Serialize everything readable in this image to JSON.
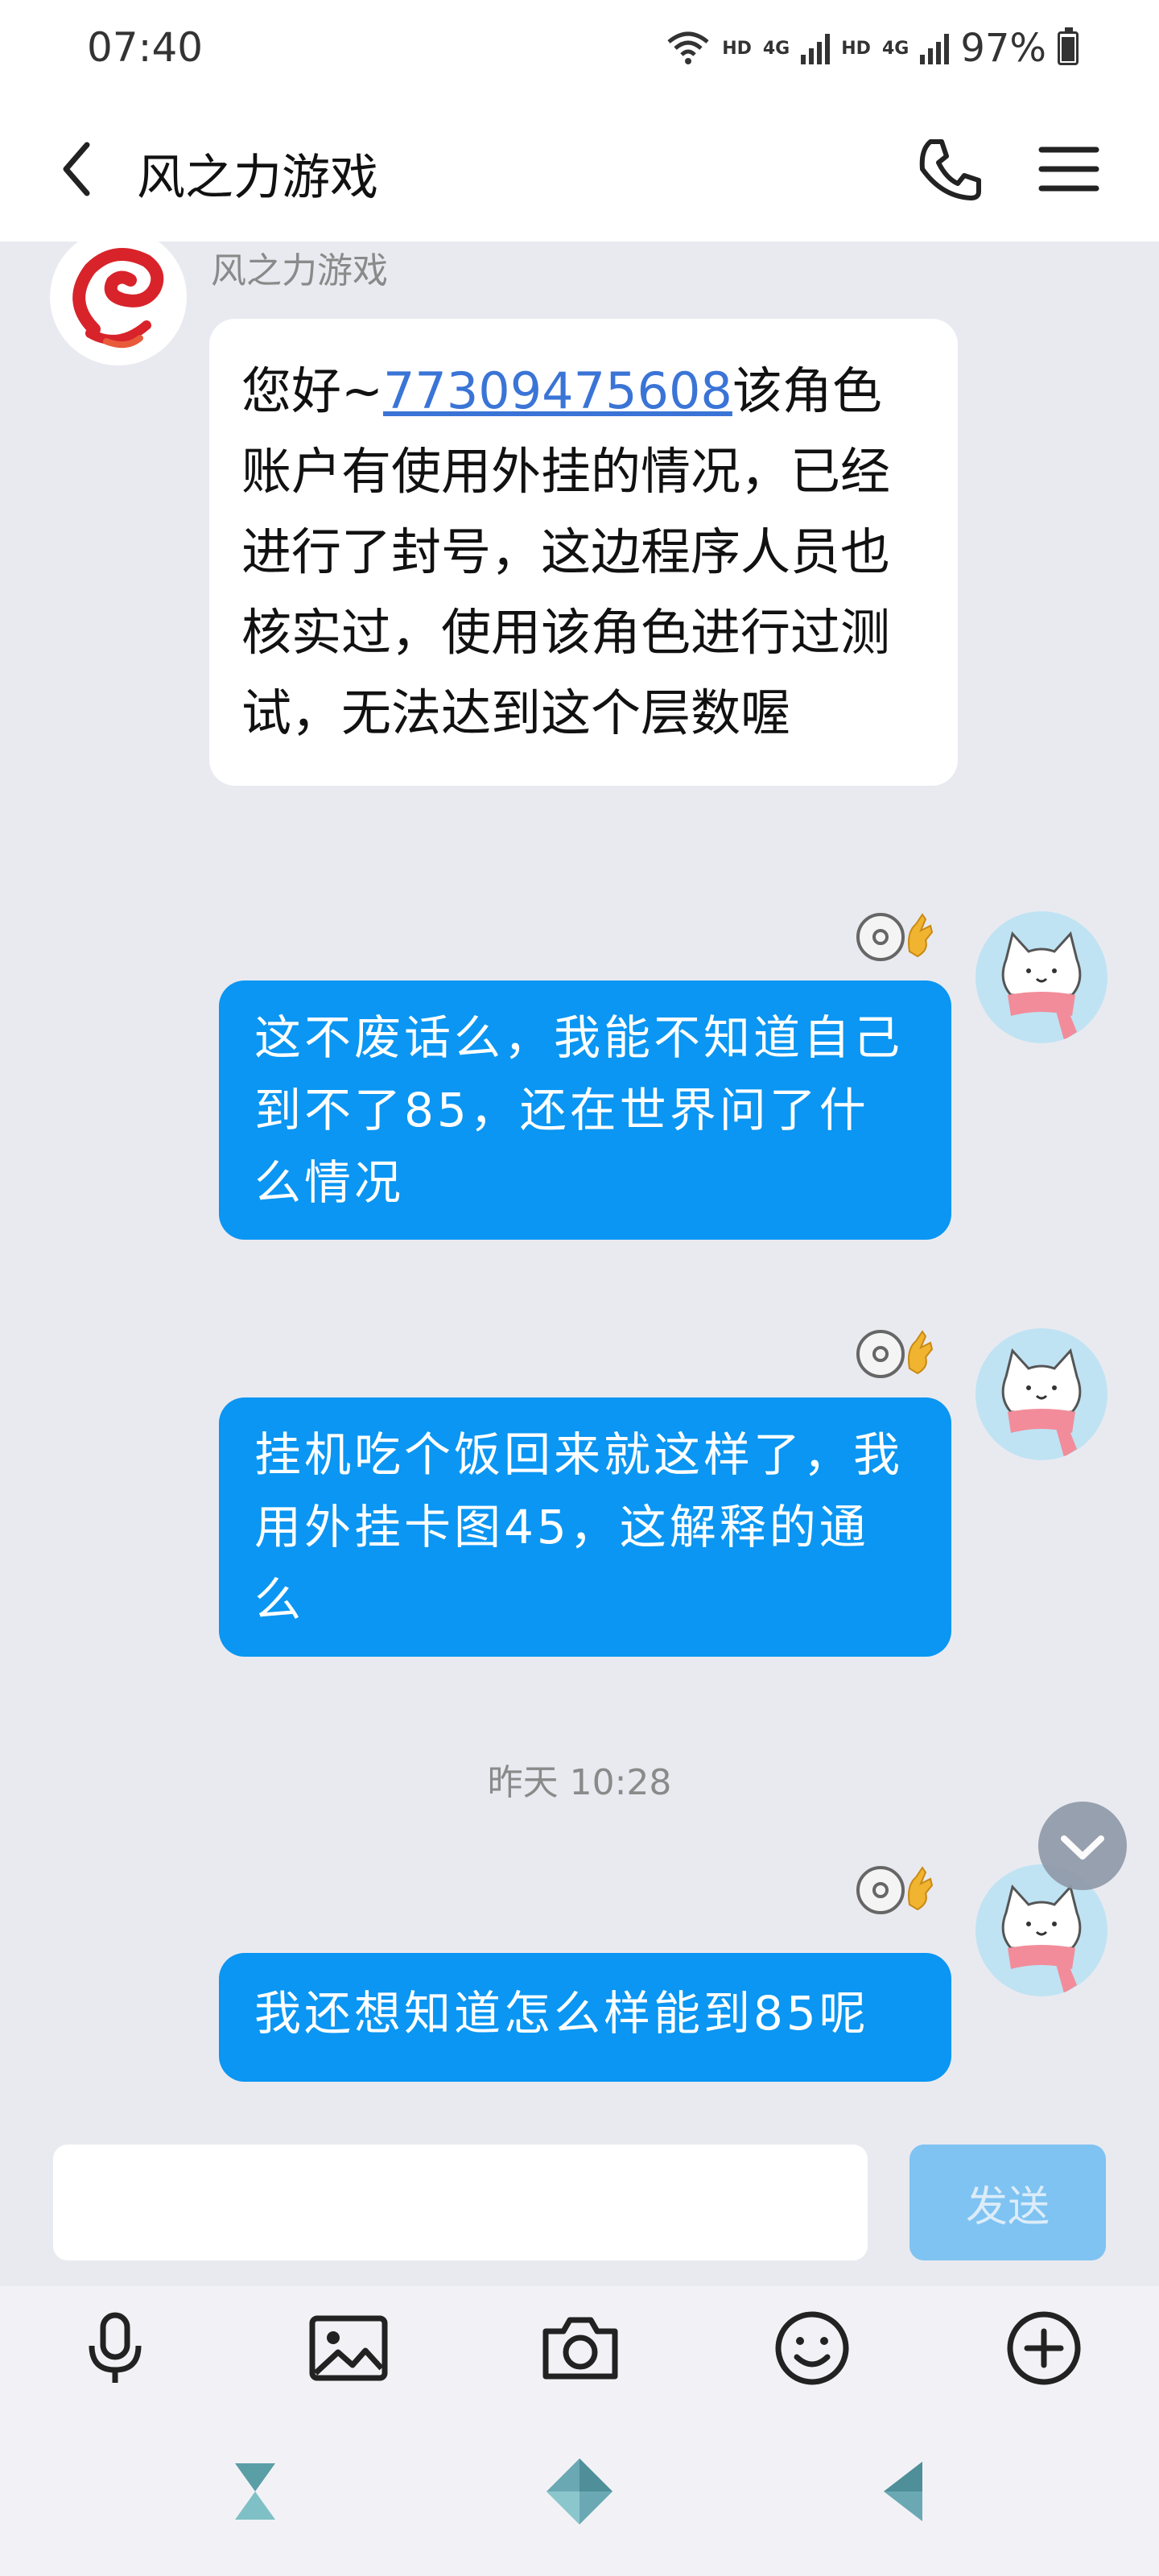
{
  "status_bar": {
    "time": "07:40",
    "hd1": "HD",
    "net1": "4G",
    "hd2": "HD",
    "net2": "4G",
    "battery": "97%"
  },
  "header": {
    "title": "风之力游戏"
  },
  "messages": {
    "incoming": {
      "sender": "风之力游戏",
      "text_before": "您好~",
      "link": "77309475608",
      "text_after": "该角色账户有使用外挂的情况，已经进行了封号，这边程序人员也核实过，使用该角色进行过测试，无法达到这个层数喔"
    },
    "outgoing": [
      {
        "text": "这不废话么，我能不知道自己到不了85，还在世界问了什么情况"
      },
      {
        "text": "挂机吃个饭回来就这样了，我用外挂卡图45，这解释的通么"
      },
      {
        "text": "我还想知道怎么样能到85呢"
      }
    ],
    "timestamp": "昨天 10:28"
  },
  "composer": {
    "placeholder": "",
    "send_label": "发送"
  },
  "colors": {
    "outgoing_bubble": "#0a96f2",
    "send_button_disabled": "#7ec3f2",
    "link": "#3a74d6"
  },
  "icons": {
    "toolbar": [
      "microphone-icon",
      "image-icon",
      "camera-icon",
      "emoji-icon",
      "plus-icon"
    ],
    "nav": [
      "recent-apps-icon",
      "home-icon",
      "back-icon"
    ]
  }
}
